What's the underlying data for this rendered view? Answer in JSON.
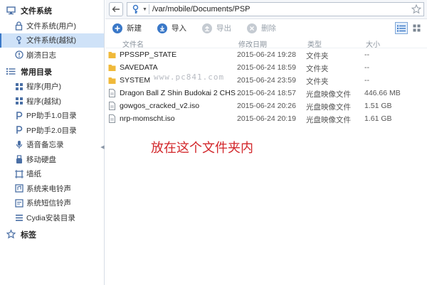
{
  "sidebar": {
    "groups": [
      {
        "label": "文件系统",
        "icon": "monitor-icon"
      },
      {
        "label": "常用目录",
        "icon": "list-icon"
      },
      {
        "label": "标签",
        "icon": "star-icon"
      }
    ],
    "fs_items": [
      {
        "label": "文件系统(用户)",
        "icon": "lock-icon"
      },
      {
        "label": "文件系统(越狱)",
        "icon": "key-icon"
      },
      {
        "label": "崩溃日志",
        "icon": "alert-icon"
      }
    ],
    "common_items": [
      {
        "label": "程序(用户)",
        "icon": "apps-icon"
      },
      {
        "label": "程序(越狱)",
        "icon": "apps-icon"
      },
      {
        "label": "PP助手1.0目录",
        "icon": "p-icon"
      },
      {
        "label": "PP助手2.0目录",
        "icon": "p-icon"
      },
      {
        "label": "语音备忘录",
        "icon": "mic-icon"
      },
      {
        "label": "移动硬盘",
        "icon": "usb-icon"
      },
      {
        "label": "墙纸",
        "icon": "wallpaper-icon"
      },
      {
        "label": "系统来电铃声",
        "icon": "ringtone-icon"
      },
      {
        "label": "系统短信铃声",
        "icon": "sms-tone-icon"
      },
      {
        "label": "Cydia安装目录",
        "icon": "menu-icon"
      }
    ]
  },
  "address": {
    "path": "/var/mobile/Documents/PSP"
  },
  "toolbar": {
    "new": "新建",
    "import": "导入",
    "export": "导出",
    "delete": "删除"
  },
  "columns": {
    "name": "文件名",
    "date": "修改日期",
    "type": "类型",
    "size": "大小"
  },
  "files": [
    {
      "name": "PPSSPP_STATE",
      "date": "2015-06-24 19:28",
      "type": "文件夹",
      "size": "--",
      "kind": "folder"
    },
    {
      "name": "SAVEDATA",
      "date": "2015-06-24 18:59",
      "type": "文件夹",
      "size": "--",
      "kind": "folder"
    },
    {
      "name": "SYSTEM",
      "date": "2015-06-24 23:59",
      "type": "文件夹",
      "size": "--",
      "kind": "folder"
    },
    {
      "name": "Dragon Ball Z  Shin Budokai 2 CHS ...",
      "date": "2015-06-24 18:57",
      "type": "光盘映像文件",
      "size": "446.66 MB",
      "kind": "file"
    },
    {
      "name": "gowgos_cracked_v2.iso",
      "date": "2015-06-24 20:26",
      "type": "光盘映像文件",
      "size": "1.51 GB",
      "kind": "file"
    },
    {
      "name": "nrp-momscht.iso",
      "date": "2015-06-24 20:19",
      "type": "光盘映像文件",
      "size": "1.61 GB",
      "kind": "file"
    }
  ],
  "watermark": "www.pc841.com",
  "annotation": "放在这个文件夹内",
  "colors": {
    "accent": "#3a78c8",
    "selected_bg": "#cfe2f8",
    "folder": "#f0b93a",
    "annotation": "#d2262a"
  }
}
